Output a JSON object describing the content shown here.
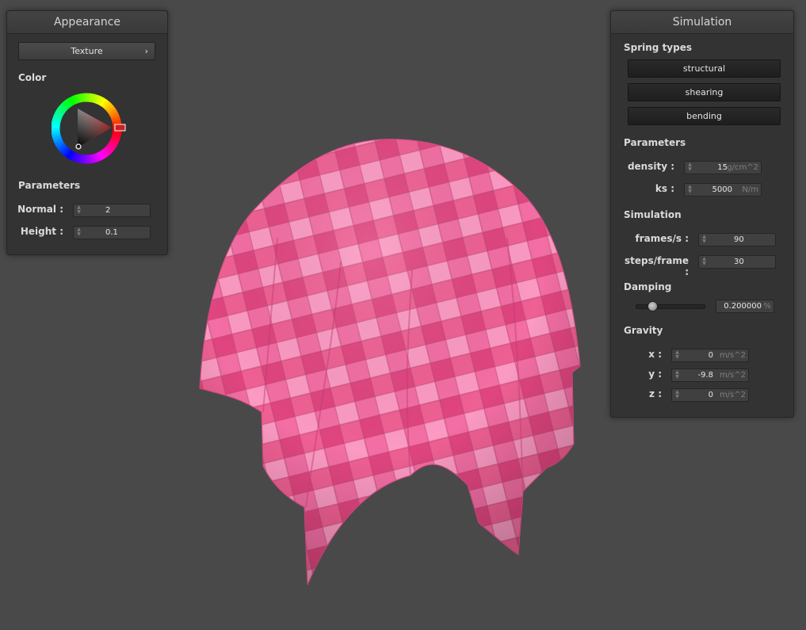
{
  "appearance": {
    "title": "Appearance",
    "texture_button": "Texture",
    "texture_arrow": "›",
    "color_label": "Color",
    "parameters_label": "Parameters",
    "normal": {
      "label": "Normal :",
      "value": "2"
    },
    "height": {
      "label": "Height :",
      "value": "0.1"
    }
  },
  "simulation": {
    "title": "Simulation",
    "spring_types_label": "Spring types",
    "spring_buttons": [
      "structural",
      "shearing",
      "bending"
    ],
    "parameters_label": "Parameters",
    "density": {
      "label": "density :",
      "value": "15",
      "unit": "g/cm^2"
    },
    "ks": {
      "label": "ks :",
      "value": "5000",
      "unit": "N/m"
    },
    "simulation_label": "Simulation",
    "fps": {
      "label": "frames/s :",
      "value": "90"
    },
    "steps": {
      "label": "steps/frame :",
      "value": "30"
    },
    "damping_label": "Damping",
    "damping": {
      "value": "0.200000",
      "unit": "%",
      "slider_fraction": 0.2
    },
    "gravity_label": "Gravity",
    "gx": {
      "label": "x :",
      "value": "0",
      "unit": "m/s^2"
    },
    "gy": {
      "label": "y :",
      "value": "-9.8",
      "unit": "m/s^2"
    },
    "gz": {
      "label": "z :",
      "value": "0",
      "unit": "m/s^2"
    }
  },
  "colors": {
    "background": "#494949",
    "panel": "#333333",
    "cloth_base": "#f06a9e",
    "selected_color": "#cc2020"
  },
  "icons": {
    "spinner": "up-down-spinner-icon",
    "submenu": "chevron-right-icon"
  }
}
